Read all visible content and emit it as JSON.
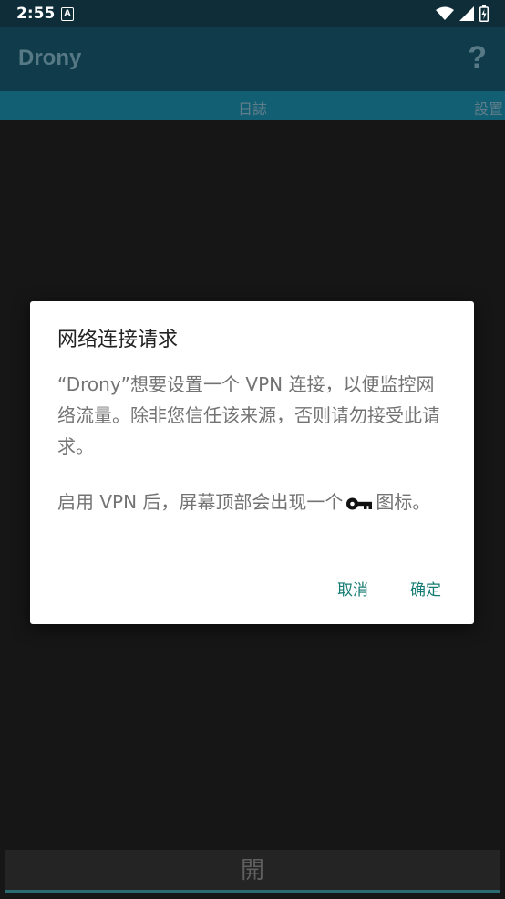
{
  "status_bar": {
    "time": "2:55",
    "notification_icon": "A"
  },
  "app_bar": {
    "title": "Drony",
    "help": "?"
  },
  "tabs": [
    {
      "label": "日誌"
    },
    {
      "label": "設置"
    }
  ],
  "bottom_button": {
    "label": "開"
  },
  "dialog": {
    "title": "网络连接请求",
    "body1": "“Drony”想要设置一个 VPN 连接，以便监控网络流量。除非您信任该来源，否则请勿接受此请求。",
    "body2_before": "启用 VPN 后，屏幕顶部会出现一个",
    "body2_after": "图标。",
    "cancel": "取消",
    "ok": "确定"
  },
  "colors": {
    "accent": "#177c74",
    "app_bar": "#0f3b4a",
    "tab_bar": "#125e73",
    "background": "#161616"
  }
}
